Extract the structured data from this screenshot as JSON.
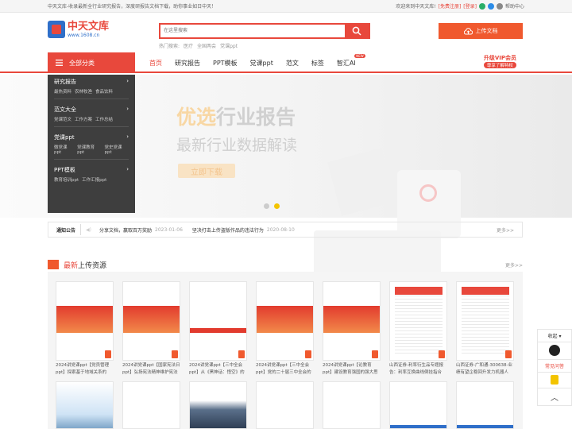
{
  "topbar": {
    "slogan": "中天文库-收录最新全行业研究报告，深度研报告文档下载，助你事业如日中天！",
    "welcome": "欢迎来到中天文库!",
    "register": "[免费注册]",
    "login": "[登录]",
    "help": "帮助中心"
  },
  "logo": {
    "name": "中天文库",
    "url": "www.1608.cn"
  },
  "search": {
    "placeholder": "在这里搜索"
  },
  "hot": {
    "label": "热门搜索:",
    "items": [
      "医疗",
      "全国两会",
      "党课ppt"
    ]
  },
  "upload_label": "上传文档",
  "nav": {
    "all_label": "全部分类",
    "items": [
      "首页",
      "研究报告",
      "PPT模板",
      "党课ppt",
      "范文",
      "标签",
      "智汇AI"
    ],
    "ai_badge": "NEW",
    "vip_title": "升级VIP会员",
    "vip_sub": "尊享了解特权"
  },
  "categories": [
    {
      "title": "研究报告",
      "subs": [
        "最热资料",
        "农林牧渔",
        "食品饮料"
      ]
    },
    {
      "title": "范文大全",
      "subs": [
        "党课范文",
        "工作方案",
        "工作总结"
      ]
    },
    {
      "title": "党课ppt",
      "subs": [
        "微党课ppt",
        "党课教育ppt",
        "党史党课ppt"
      ]
    },
    {
      "title": "PPT模板",
      "subs": [
        "教育培训ppt",
        "工作汇报ppt"
      ]
    }
  ],
  "banner": {
    "title_a": "优选",
    "title_b": "行业报告",
    "subtitle": "最新行业数据解读",
    "button": "立即下载"
  },
  "notice": {
    "label": "通知公告",
    "items": [
      {
        "text": "分享文档，赢取百万奖励",
        "date": "2023-01-06"
      },
      {
        "text": "坚决打击上传盗版作品的违法行为",
        "date": "2020-08-10"
      }
    ],
    "more": "更多>>"
  },
  "section": {
    "title_a": "最新",
    "title_b": "上传资源",
    "more": "更多>>"
  },
  "cards": [
    {
      "caption": "2024讲党课ppt【党员管理ppt】探索基于地域关系的"
    },
    {
      "caption": "2024讲党课ppt【国家宪法日ppt】弘扬宪法精神维护宪法"
    },
    {
      "caption": "2024讲党课ppt【三中全会ppt】从《黑神话：悟空》的"
    },
    {
      "caption": "2024讲党课ppt【三中全会ppt】党的二十届三中全会的"
    },
    {
      "caption": "2024讲党课ppt【论教育ppt】建设教育强国的强大思想武"
    },
    {
      "caption": "山西证券-利率衍生品专题报告：利率互换曲线倒挂指合"
    },
    {
      "caption": "山西证券-广和通-300638-业绩有望企稳回升发力机器人"
    }
  ],
  "side": {
    "fold": "收起",
    "qa": "常见问答"
  }
}
